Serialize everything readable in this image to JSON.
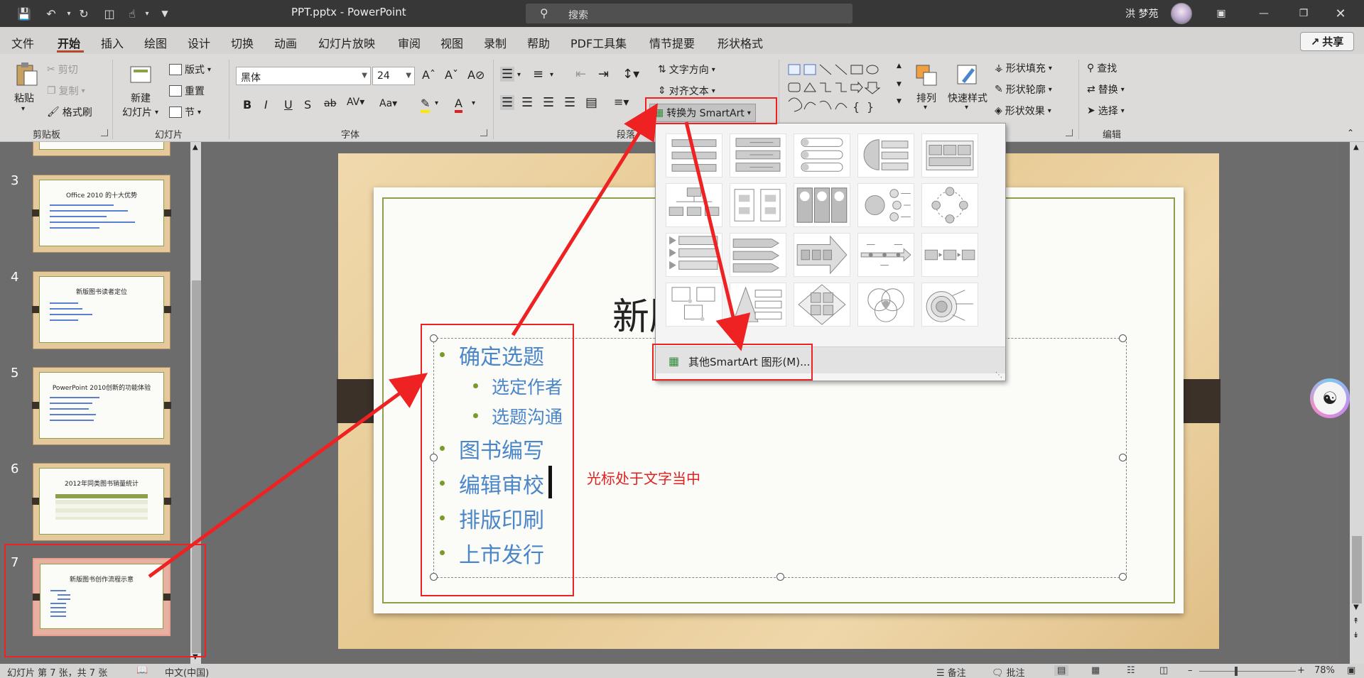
{
  "window": {
    "doc_title": "PPT.pptx  -  PowerPoint",
    "search_placeholder": "搜索",
    "user_name": "洪 梦苑"
  },
  "menu": {
    "tabs": [
      "文件",
      "开始",
      "插入",
      "绘图",
      "设计",
      "切换",
      "动画",
      "幻灯片放映",
      "审阅",
      "视图",
      "录制",
      "帮助",
      "PDF工具集",
      "情节提要",
      "形状格式"
    ],
    "active": "开始",
    "share": "共享"
  },
  "ribbon": {
    "clipboard": {
      "paste": "粘贴",
      "cut": "剪切",
      "copy": "复制",
      "format_painter": "格式刷",
      "label": "剪贴板"
    },
    "slides": {
      "new_slide_line1": "新建",
      "new_slide_line2": "幻灯片",
      "layout": "版式",
      "reset": "重置",
      "section": "节",
      "label": "幻灯片"
    },
    "font": {
      "name": "黑体",
      "size": "24",
      "label": "字体"
    },
    "paragraph": {
      "text_direction": "文字方向",
      "align_text": "对齐文本",
      "convert_smartart": "转换为 SmartArt",
      "label": "段落"
    },
    "drawing": {
      "arrange": "排列",
      "quick_styles": "快速样式",
      "shape_fill": "形状填充",
      "shape_outline": "形状轮廓",
      "shape_effects": "形状效果"
    },
    "editing": {
      "find": "查找",
      "replace": "替换",
      "select": "选择",
      "label": "编辑"
    }
  },
  "thumbnails": [
    {
      "num": "3",
      "title": "Office 2010 的十大优势"
    },
    {
      "num": "4",
      "title": "新版图书读者定位"
    },
    {
      "num": "5",
      "title": "PowerPoint 2010创新的功能体验"
    },
    {
      "num": "6",
      "title": "2012年同类图书销量统计"
    },
    {
      "num": "7",
      "title": "新版图书创作流程示意"
    }
  ],
  "slide": {
    "title_visible": "新版",
    "bullets": [
      {
        "text": "确定选题",
        "level": 1
      },
      {
        "text": "选定作者",
        "level": 2
      },
      {
        "text": "选题沟通",
        "level": 2
      },
      {
        "text": "图书编写",
        "level": 1
      },
      {
        "text": "编辑审校",
        "level": 1
      },
      {
        "text": "排版印刷",
        "level": 1
      },
      {
        "text": "上市发行",
        "level": 1
      }
    ],
    "annotation": "光标处于文字当中"
  },
  "smartart_dropdown": {
    "more_label": "其他SmartArt 图形(M)..."
  },
  "status": {
    "slide_info": "幻灯片 第 7 张，共 7 张",
    "language": "中文(中国)",
    "notes": "备注",
    "comments": "批注",
    "zoom": "78%"
  },
  "colors": {
    "accent": "#b7472a",
    "bullet_text": "#4a86c8",
    "annotation": "#e02020"
  }
}
